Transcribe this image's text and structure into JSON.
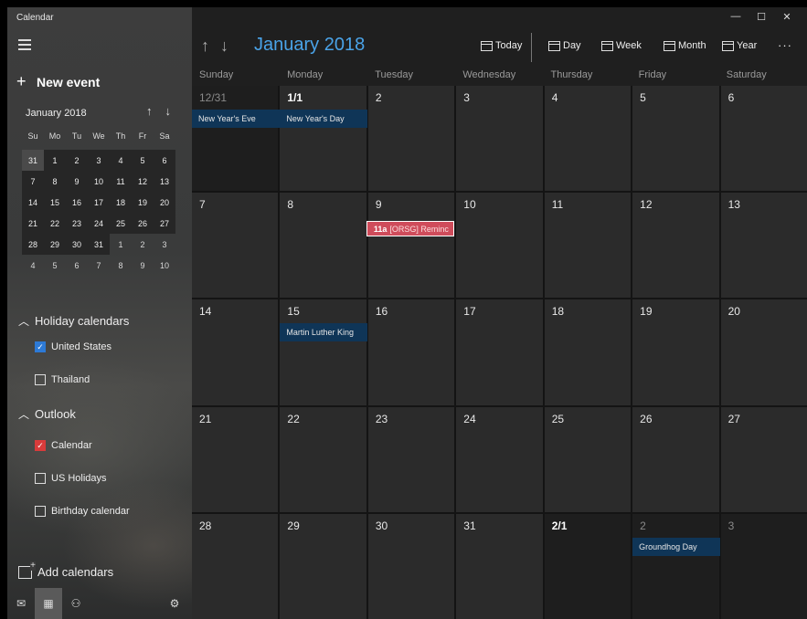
{
  "app": {
    "title": "Calendar"
  },
  "sidebar": {
    "new_event": "New event",
    "mini_calendar": {
      "month_label": "January 2018",
      "days_of_week": [
        "Su",
        "Mo",
        "Tu",
        "We",
        "Th",
        "Fr",
        "Sa"
      ],
      "weeks": [
        [
          "31",
          "1",
          "2",
          "3",
          "4",
          "5",
          "6"
        ],
        [
          "7",
          "8",
          "9",
          "10",
          "11",
          "12",
          "13"
        ],
        [
          "14",
          "15",
          "16",
          "17",
          "18",
          "19",
          "20"
        ],
        [
          "21",
          "22",
          "23",
          "24",
          "25",
          "26",
          "27"
        ],
        [
          "28",
          "29",
          "30",
          "31",
          "1",
          "2",
          "3"
        ],
        [
          "4",
          "5",
          "6",
          "7",
          "8",
          "9",
          "10"
        ]
      ]
    },
    "holiday_section": "Holiday calendars",
    "holiday_items": [
      {
        "label": "United States",
        "checked": true,
        "color": "#2d7ad6"
      },
      {
        "label": "Thailand",
        "checked": false
      }
    ],
    "outlook_section": "Outlook",
    "outlook_items": [
      {
        "label": "Calendar",
        "checked": true,
        "color": "#d83b3b"
      },
      {
        "label": "US Holidays",
        "checked": false
      },
      {
        "label": "Birthday calendar",
        "checked": false
      }
    ],
    "add_calendars": "Add calendars"
  },
  "header": {
    "month_title": "January 2018",
    "today_label": "Today",
    "day_label": "Day",
    "week_label": "Week",
    "month_label": "Month",
    "year_label": "Year"
  },
  "weekdays": [
    "Sunday",
    "Monday",
    "Tuesday",
    "Wednesday",
    "Thursday",
    "Friday",
    "Saturday"
  ],
  "month_grid": [
    [
      "12/31",
      "1/1",
      "2",
      "3",
      "4",
      "5",
      "6"
    ],
    [
      "7",
      "8",
      "9",
      "10",
      "11",
      "12",
      "13"
    ],
    [
      "14",
      "15",
      "16",
      "17",
      "18",
      "19",
      "20"
    ],
    [
      "21",
      "22",
      "23",
      "24",
      "25",
      "26",
      "27"
    ],
    [
      "28",
      "29",
      "30",
      "31",
      "2/1",
      "2",
      "3"
    ]
  ],
  "events": {
    "new_years_eve": "New Year's Eve",
    "new_years_day": "New Year's Day",
    "reminder_time": "11a",
    "reminder_text": "[ORSG] Reminc",
    "mlk": "Martin Luther King",
    "groundhog": "Groundhog Day"
  },
  "colors": {
    "accent": "#4aa3e8",
    "event_bg": "#0f3557",
    "reminder_bg": "#cf4c5b"
  }
}
